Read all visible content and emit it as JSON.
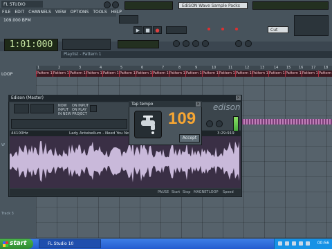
{
  "app": {
    "title": "FL STUDIO",
    "menu": [
      "FILE",
      "EDIT",
      "CHANNELS",
      "VIEW",
      "OPTIONS",
      "TOOLS",
      "HELP"
    ],
    "bpm_text": "109.000 BPM",
    "time_display": "1:01:000",
    "preset_text": "EdiSON Wave Sample Packs",
    "cut_label": "Cut"
  },
  "playlist": {
    "title": "Playlist - Pattern 1",
    "loop_label": "LOOP",
    "ruler_numbers": [
      "1",
      "2",
      "3",
      "4",
      "5",
      "6",
      "7",
      "8",
      "9",
      "10",
      "11",
      "12",
      "13",
      "14",
      "15",
      "16",
      "17",
      "18"
    ],
    "pattern_clip_label": "Pattern 1",
    "track_labels": [
      "W",
      "Track 3"
    ]
  },
  "edison": {
    "title": "Edison (Master)",
    "options": [
      "NOW",
      "ON INPUT",
      "INPUT",
      "ON PLAY",
      "IN NEW PROJECT"
    ],
    "sample_rate": "44100Hz",
    "file_name": "Lady Antebellum - Need You Now (OFFI...",
    "duration": "3:29:919",
    "status": [
      "PAUSE",
      "Start",
      "Stop",
      "MAGNET",
      "LOOP",
      "Speed"
    ],
    "logo": "edison"
  },
  "tap_tempo": {
    "title": "Tap tempo",
    "value": "109",
    "accept_label": "Accept"
  },
  "taskbar": {
    "start_label": "start",
    "task_label": "FL Studio 10",
    "clock": "00:56"
  },
  "colors": {
    "tempo_orange": "#f7a633",
    "pattern_red": "#aa2a3e",
    "start_green": "#3b9e3b",
    "taskbar_blue": "#2f6ad9"
  },
  "icons": [
    "close-icon",
    "play-icon",
    "stop-icon",
    "record-icon",
    "tap-faucet-icon",
    "windows-logo-icon"
  ]
}
